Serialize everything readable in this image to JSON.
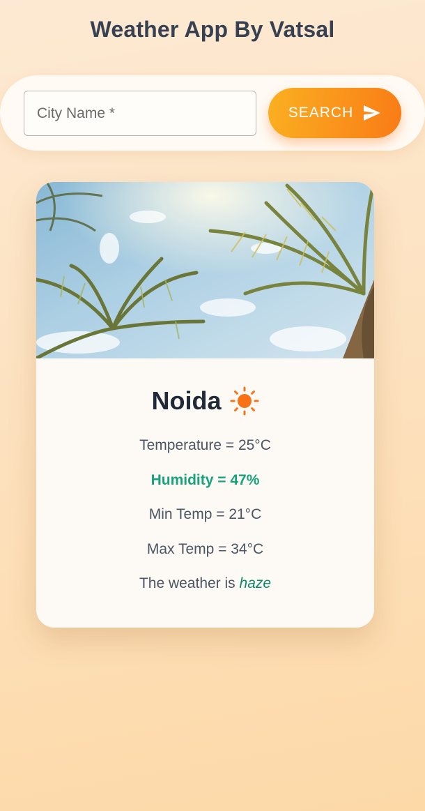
{
  "header": {
    "title": "Weather App By Vatsal"
  },
  "search": {
    "placeholder": "City Name *",
    "value": "",
    "button_label": "SEARCH"
  },
  "card": {
    "city": "Noida",
    "temperature": "Temperature = 25°C",
    "humidity": "Humidity = 47%",
    "min_temp": "Min Temp = 21°C",
    "max_temp": "Max Temp = 34°C",
    "description_prefix": "The weather is",
    "description": "haze",
    "weather_icon": "sun-icon",
    "image_subject": "palm-trees-sky"
  },
  "colors": {
    "accent_start": "#fbb021",
    "accent_end": "#f97b16",
    "humidity": "#16a37a",
    "sun": "#f97316"
  }
}
